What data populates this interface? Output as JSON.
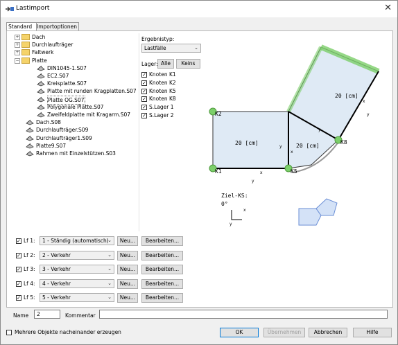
{
  "window": {
    "title": "Lastimport"
  },
  "tabs": [
    "Standard",
    "Importoptionen"
  ],
  "tree": [
    {
      "label": "Dach",
      "type": "folder",
      "expander": "+",
      "level": 0
    },
    {
      "label": "Durchlaufträger",
      "type": "folder",
      "expander": "+",
      "level": 0
    },
    {
      "label": "Faltwerk",
      "type": "folder",
      "expander": "+",
      "level": 0
    },
    {
      "label": "Platte",
      "type": "folder",
      "expander": "−",
      "level": 0
    },
    {
      "label": "DIN1045-1.S07",
      "type": "plate",
      "level": 1
    },
    {
      "label": "EC2.S07",
      "type": "plate",
      "level": 1
    },
    {
      "label": "Kreisplatte.S07",
      "type": "plate",
      "level": 1
    },
    {
      "label": "Platte mit runden Kragplatten.S07",
      "type": "plate",
      "level": 1
    },
    {
      "label": "Platte OG.S07",
      "type": "plate",
      "level": 1,
      "selected": true
    },
    {
      "label": "Polygonale Platte.S07",
      "type": "plate",
      "level": 1
    },
    {
      "label": "Zweifeldplatte mit Kragarm.S07",
      "type": "plate",
      "level": 1
    },
    {
      "label": "Dach.S08",
      "type": "roof",
      "level": 0
    },
    {
      "label": "Durchlaufträger.S09",
      "type": "beam",
      "level": 0
    },
    {
      "label": "Durchlaufträger1.S09",
      "type": "beam",
      "level": 0
    },
    {
      "label": "Platte9.S07",
      "type": "plate",
      "level": 0
    },
    {
      "label": "Rahmen mit Einzelstützen.S03",
      "type": "frame",
      "level": 0
    }
  ],
  "ergebnistyp": {
    "label": "Ergebnistyp:",
    "value": "Lastfälle"
  },
  "lager": {
    "label": "Lager:",
    "all": "Alle",
    "none": "Keins"
  },
  "lager_items": [
    {
      "label": "Knoten K1",
      "checked": true
    },
    {
      "label": "Knoten K2",
      "checked": true
    },
    {
      "label": "Knoten K5",
      "checked": true
    },
    {
      "label": "Knoten K8",
      "checked": true
    },
    {
      "label": "S.Lager 1",
      "checked": true
    },
    {
      "label": "S.Lager 2",
      "checked": true
    }
  ],
  "preview": {
    "node_labels": [
      "K2",
      "K1",
      "K5",
      "K8"
    ],
    "dim_labels": [
      "20 [cm]",
      "20 [cm]",
      "20 [cm]"
    ],
    "axis_x": "x",
    "axis_y": "y",
    "ziel_ks_label": "Ziel-KS:",
    "ziel_ks_angle": "0°"
  },
  "load_cases": [
    {
      "label": "Lf 1:",
      "value": "1 - Ständig (automatisch)",
      "checked": true
    },
    {
      "label": "Lf 2:",
      "value": "2 - Verkehr",
      "checked": true
    },
    {
      "label": "Lf 3:",
      "value": "3 - Verkehr",
      "checked": true
    },
    {
      "label": "Lf 4:",
      "value": "4 - Verkehr",
      "checked": true
    },
    {
      "label": "Lf 5:",
      "value": "5 - Verkehr",
      "checked": true
    }
  ],
  "lf_buttons": {
    "new": "Neu...",
    "edit": "Bearbeiten..."
  },
  "name": {
    "label": "Name",
    "value": "2"
  },
  "kommentar": {
    "label": "Kommentar",
    "value": ""
  },
  "mehrere": {
    "label": "Mehrere Objekte nacheinander erzeugen",
    "checked": false
  },
  "footer": {
    "ok": "OK",
    "apply": "Übernehmen",
    "cancel": "Abbrechen",
    "help": "Hilfe"
  },
  "colors": {
    "plate_fill": "#dfeaf5",
    "support_green": "#7ccf6a",
    "accent": "#0078d7"
  }
}
